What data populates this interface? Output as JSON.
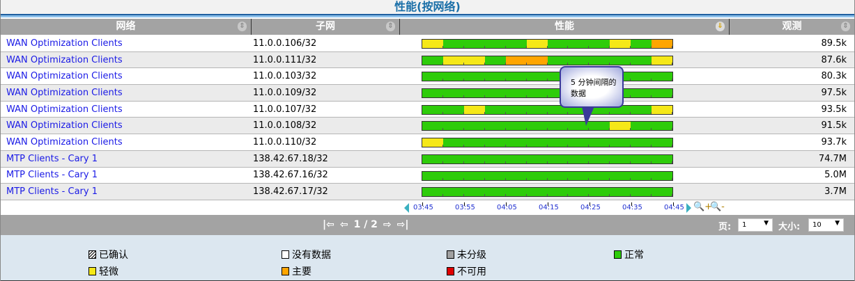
{
  "title": "性能(按网络)",
  "columns": {
    "network": "网络",
    "subnet": "子网",
    "performance": "性能",
    "observed": "观测"
  },
  "colors": {
    "G": "#2ecc0a",
    "Y": "#f5e818",
    "O": "#ffa500",
    "R": "#e00000",
    "U": "#a0a0a0"
  },
  "rows": [
    {
      "network": "WAN Optimization Clients",
      "subnet": "11.0.0.106/32",
      "obs": "89.5k",
      "segs": "YGGGGYGGGYGO"
    },
    {
      "network": "WAN Optimization Clients",
      "subnet": "11.0.0.111/32",
      "obs": "87.6k",
      "segs": "GYYGOOGGGGGY"
    },
    {
      "network": "WAN Optimization Clients",
      "subnet": "11.0.0.103/32",
      "obs": "80.3k",
      "segs": "GGGGGGGGGGGG"
    },
    {
      "network": "WAN Optimization Clients",
      "subnet": "11.0.0.109/32",
      "obs": "97.5k",
      "segs": "GGGGGGGGGGGG"
    },
    {
      "network": "WAN Optimization Clients",
      "subnet": "11.0.0.107/32",
      "obs": "93.5k",
      "segs": "GGYGGGGGGGGY"
    },
    {
      "network": "WAN Optimization Clients",
      "subnet": "11.0.0.108/32",
      "obs": "91.5k",
      "segs": "GGGGGGGGGYGG"
    },
    {
      "network": "WAN Optimization Clients",
      "subnet": "11.0.0.110/32",
      "obs": "93.7k",
      "segs": "YGGGGGGGGGGG"
    },
    {
      "network": "MTP Clients - Cary 1",
      "subnet": "138.42.67.18/32",
      "obs": "74.7M",
      "segs": "GGGGGGGGGGGG"
    },
    {
      "network": "MTP Clients - Cary 1",
      "subnet": "138.42.67.16/32",
      "obs": "5.0M",
      "segs": "GGGGGGGGGGGG"
    },
    {
      "network": "MTP Clients - Cary 1",
      "subnet": "138.42.67.17/32",
      "obs": "3.7M",
      "segs": "GGGGGGGGGGGG"
    }
  ],
  "axis_ticks": [
    "03:45",
    "03:55",
    "04:05",
    "04:15",
    "04:25",
    "04:35",
    "04:45"
  ],
  "tooltip": "5 分钟间隔的数据",
  "pager": {
    "page_indicator": "1 / 2",
    "page_label": "页:",
    "page_value": "1",
    "size_label": "大小:",
    "size_value": "10"
  },
  "legend": [
    {
      "label": "已确认",
      "color": "hatch"
    },
    {
      "label": "没有数据",
      "color": "#ffffff"
    },
    {
      "label": "未分级",
      "color": "#a0a0a0"
    },
    {
      "label": "正常",
      "color": "#2ecc0a"
    },
    {
      "label": "轻微",
      "color": "#f5e818"
    },
    {
      "label": "主要",
      "color": "#ffa500"
    },
    {
      "label": "不可用",
      "color": "#e00000"
    }
  ]
}
